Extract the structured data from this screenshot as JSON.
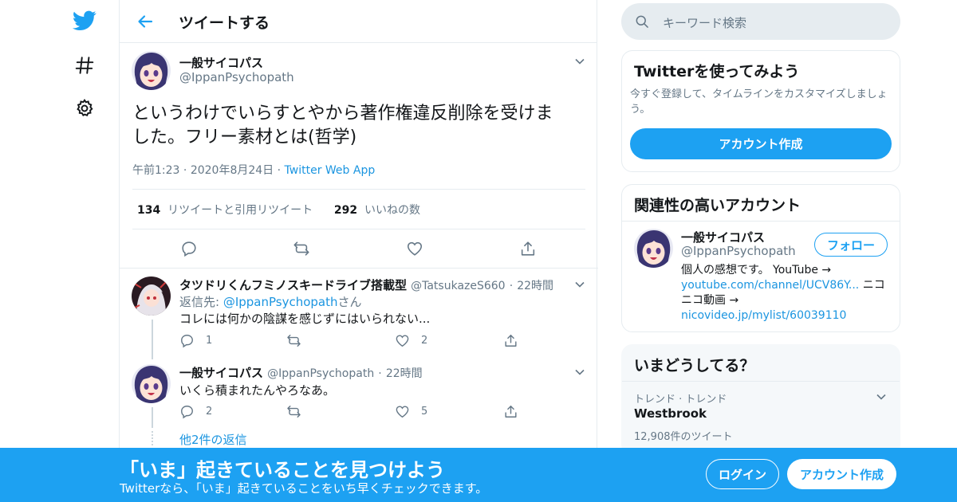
{
  "colors": {
    "accent": "#1da1f2",
    "link": "#1b95e0",
    "muted": "#657786",
    "border": "#e6ecf0"
  },
  "nav": {
    "icons": [
      "twitter-bird-icon",
      "hashtag-icon",
      "gear-icon"
    ]
  },
  "header": {
    "title": "ツイートする"
  },
  "main_tweet": {
    "name": "一般サイコパス",
    "handle": "@IppanPsychopath",
    "text_line1": "というわけでいらすとやから著作権違反削除を受けま",
    "text_line2": "した。フリー素材とは(哲学)",
    "time": "午前1:23",
    "date": "2020年8月24日",
    "source": "Twitter Web App",
    "retweet_count": "134",
    "retweet_label": "リツイートと引用リツイート",
    "like_count": "292",
    "like_label": "いいねの数"
  },
  "replies": [
    {
      "name": "タツドリくんフミノスキードライブ搭載型",
      "handle": "@TatsukazeS660",
      "time": "22時間",
      "reply_prefix": "返信先: ",
      "reply_to": "@IppanPsychopath",
      "reply_suffix": "さん",
      "text": "コレには何かの陰謀を感じずにはいられない...",
      "reply_count": "1",
      "retweet_count": "",
      "like_count": "2"
    },
    {
      "name": "一般サイコパス",
      "handle": "@IppanPsychopath",
      "time": "22時間",
      "text": "いくら積まれたんやろなあ。",
      "reply_count": "2",
      "retweet_count": "",
      "like_count": "5"
    }
  ],
  "more_replies": "他2件の返信",
  "search": {
    "placeholder": "キーワード検索"
  },
  "signup_card": {
    "title": "Twitterを使ってみよう",
    "description": "今すぐ登録して、タイムラインをカスタマイズしましょう。",
    "button": "アカウント作成"
  },
  "related_card": {
    "title": "関連性の高いアカウント",
    "name": "一般サイコパス",
    "handle": "@IppanPsychopath",
    "follow": "フォロー",
    "bio_line1": "個人の感想です。 YouTube →",
    "bio_link1": "youtube.com/channel/UCV86Y...",
    "bio_mid1": " ニコ",
    "bio_line3": "ニコ動画 →",
    "bio_link2": "nicovideo.jp/mylist/60039110"
  },
  "trends_card": {
    "title": "いまどうしてる？",
    "category": "トレンド · トレンド",
    "topic": "Westbrook",
    "count": "12,908件のツイート"
  },
  "banner": {
    "title": "「いま」起きていることを見つけよう",
    "subtitle": "Twitterなら、「いま」起きていることをいち早くチェックできます。",
    "login": "ログイン",
    "signup": "アカウント作成"
  }
}
